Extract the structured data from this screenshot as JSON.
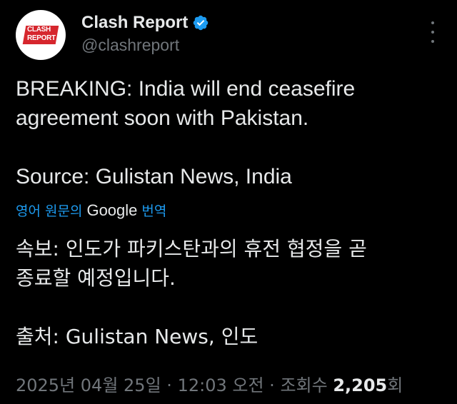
{
  "author": {
    "display_name": "Clash Report",
    "handle": "@clashreport",
    "avatar_text_top": "CLASH",
    "avatar_text_bottom": "REPORT"
  },
  "tweet": {
    "text": "BREAKING: India will end ceasefire\nagreement soon with Pakistan.\n\nSource: Gulistan News, India"
  },
  "translation": {
    "prefix": "영어 원문의",
    "brand": "Google",
    "suffix": "번역",
    "text": "속보: 인도가 파키스탄과의 휴전 협정을 곧\n종료할 예정입니다.\n\n출처: Gulistan News, 인도"
  },
  "meta": {
    "date": "2025년 04월 25일",
    "time": "12:03 오전",
    "views_label": "조회수",
    "views_count": "2,205",
    "views_suffix": "회",
    "separator": "·"
  },
  "colors": {
    "background": "#000000",
    "text": "#e7e9ea",
    "muted": "#71767b",
    "link": "#1d9bf0",
    "verified": "#1d9bf0",
    "logo_red": "#d6262d"
  }
}
